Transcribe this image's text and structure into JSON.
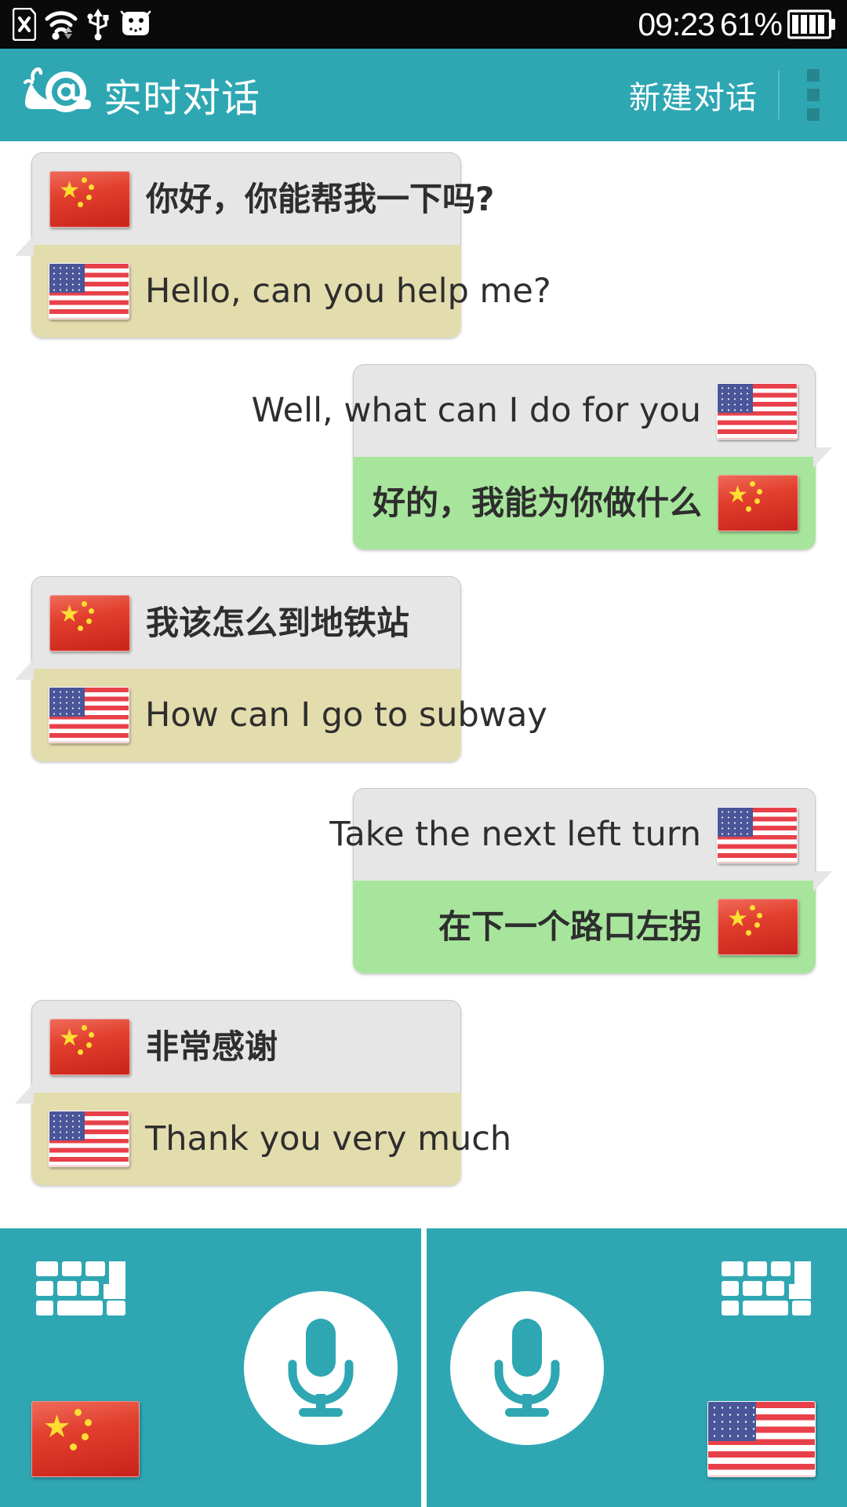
{
  "statusbar": {
    "time": "09:23",
    "battery_percent": "61%",
    "icons": [
      "sdcard-error-icon",
      "wifi-icon",
      "usb-icon",
      "android-icon",
      "battery-icon"
    ]
  },
  "header": {
    "logo": "snail-at-logo",
    "title": "实时对话",
    "new_chat_label": "新建对话",
    "overflow_label": "overflow-menu-icon",
    "bg_color": "#2ea7b3"
  },
  "chat": {
    "messages": [
      {
        "side": "left",
        "source_flag": "cn",
        "source_text": "你好，你能帮我一下吗?",
        "target_flag": "us",
        "target_text": "Hello, can you help me?",
        "target_color": "#e3dcad"
      },
      {
        "side": "right",
        "source_flag": "us",
        "source_text": "Well, what can I do for you",
        "target_flag": "cn",
        "target_text": "好的，我能为你做什么",
        "target_color": "#a7e59c"
      },
      {
        "side": "left",
        "source_flag": "cn",
        "source_text": "我该怎么到地铁站",
        "target_flag": "us",
        "target_text": "How can I go to subway",
        "target_color": "#e3dcad"
      },
      {
        "side": "right",
        "source_flag": "us",
        "source_text": "Take the next left turn",
        "target_flag": "cn",
        "target_text": "在下一个路口左拐",
        "target_color": "#a7e59c"
      },
      {
        "side": "left",
        "source_flag": "cn",
        "source_text": "非常感谢",
        "target_flag": "us",
        "target_text": "Thank you very much",
        "target_color": "#e3dcad"
      }
    ],
    "source_bubble_color": "#e6e6e6"
  },
  "bottombar": {
    "left": {
      "keyboard": "keyboard-icon",
      "mic": "microphone-icon",
      "flag": "cn"
    },
    "right": {
      "mic": "microphone-icon",
      "keyboard": "keyboard-icon",
      "flag": "us"
    },
    "bg_color": "#2ea7b3"
  }
}
